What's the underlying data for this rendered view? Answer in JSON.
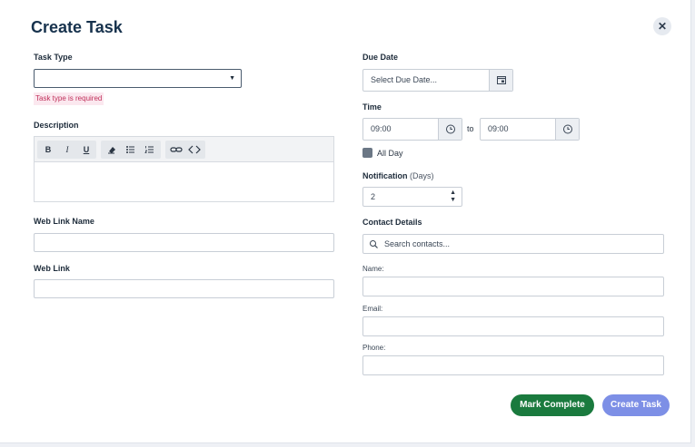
{
  "dialog": {
    "title": "Create Task",
    "close_icon": "close-icon"
  },
  "task_type": {
    "label": "Task Type",
    "value": "",
    "error": "Task type is required"
  },
  "description": {
    "label": "Description",
    "toolbar": {
      "bold": "B",
      "italic": "I",
      "underline": "U",
      "icons": [
        "eraser-icon",
        "bullet-list-icon",
        "numbered-list-icon",
        "link-icon",
        "code-icon"
      ]
    },
    "value": ""
  },
  "web_link_name": {
    "label": "Web Link Name",
    "value": ""
  },
  "web_link": {
    "label": "Web Link",
    "value": ""
  },
  "due_date": {
    "label": "Due Date",
    "placeholder": "Select Due Date...",
    "icon": "calendar-icon"
  },
  "time": {
    "label": "Time",
    "start": "09:00",
    "separator": "to",
    "end": "09:00",
    "icon": "clock-icon"
  },
  "all_day": {
    "label": "All Day",
    "checked": false
  },
  "notification": {
    "label": "Notification",
    "unit": "(Days)",
    "value": "2"
  },
  "contact_details": {
    "label": "Contact Details",
    "search_placeholder": "Search contacts...",
    "name_label": "Name:",
    "email_label": "Email:",
    "phone_label": "Phone:",
    "name": "",
    "email": "",
    "phone": ""
  },
  "actions": {
    "mark_complete": "Mark Complete",
    "create_task": "Create Task"
  },
  "colors": {
    "title": "#17324d",
    "error_text": "#c0305a",
    "error_bg": "#fbe8ef",
    "mark_complete": "#1a7a3e",
    "create_task": "#7d8fe6"
  }
}
